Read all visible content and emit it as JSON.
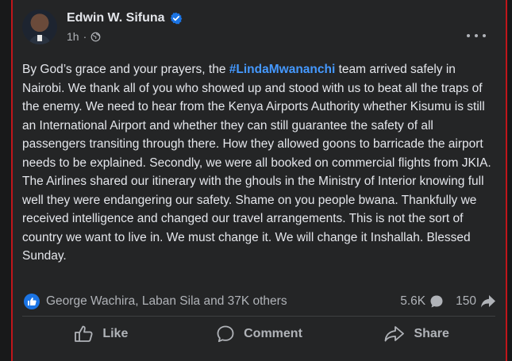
{
  "post": {
    "author": "Edwin W. Sifuna",
    "time": "1h",
    "separator": "·",
    "text_before_hashtag": "By God’s grace and your prayers, the ",
    "hashtag": "#LindaMwananchi",
    "text_after_hashtag": " team arrived safely in Nairobi. We thank all of you who showed up and stood with us to beat all the traps of the enemy. We need to hear from the Kenya Airports Authority whether Kisumu is still an International Airport and whether they can still guarantee the safety of all passengers transiting through there. How they allowed goons to barricade the airport needs to be explained. Secondly, we were all booked on commercial flights from JKIA. The Airlines shared our itinerary with the ghouls in the Ministry of Interior knowing full well they were endangering our safety. Shame on you people bwana. Thankfully we received intelligence and changed our travel arrangements. This is not the sort of country we want to live in. We must change it.  We will change it Inshallah. Blessed Sunday."
  },
  "engagement": {
    "reactors": "George Wachira, Laban Sila and 37K others",
    "comments_count": "5.6K",
    "shares_count": "150"
  },
  "actions": {
    "like": "Like",
    "comment": "Comment",
    "share": "Share"
  },
  "colors": {
    "background": "#242526",
    "text": "#e4e6eb",
    "muted": "#b0b3b8",
    "accent": "#4599ff",
    "like_blue": "#1b74e4"
  },
  "icons": [
    "verified-badge-icon",
    "globe-icon",
    "more-options-icon",
    "like-reaction-icon",
    "comment-count-icon",
    "share-count-icon",
    "like-icon",
    "comment-icon",
    "share-icon"
  ]
}
